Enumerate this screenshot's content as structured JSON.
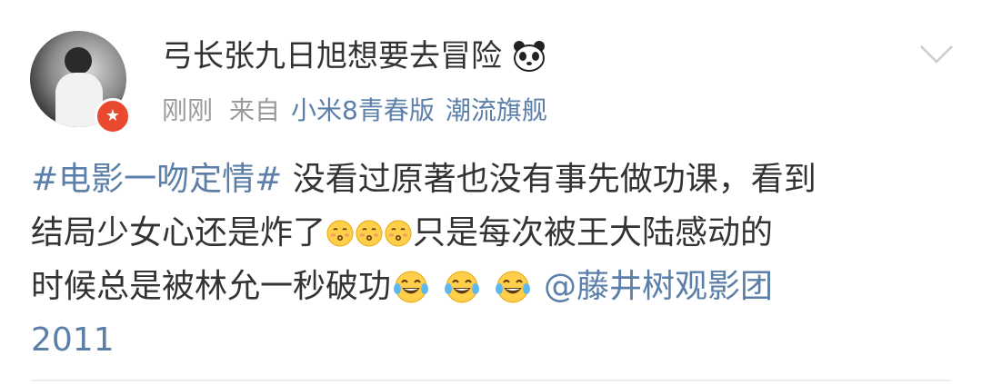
{
  "post": {
    "username": "弓长张九日旭想要去冒险",
    "time": "刚刚",
    "source_prefix": "来自",
    "source_device": "小米8青春版",
    "source_tag": "潮流旗舰",
    "lines": [
      {
        "hashtag": "#电影一吻定情#",
        "text": " 没看过原著也没有事先做功课，看到"
      },
      {
        "text_a": "结局少女心还是炸了",
        "text_b": "只是每次被王大陆感动的"
      },
      {
        "text": "时候总是被林允一秒破功",
        "mention": "@藤井树观影团"
      },
      {
        "number": "2011"
      }
    ]
  },
  "icons": {
    "panda": "panda-emoji-icon",
    "chevron": "chevron-down-icon",
    "badge": "verified-badge-icon",
    "kiss": "kissing-face-emoji-icon",
    "laugh": "tears-of-joy-emoji-icon"
  },
  "colors": {
    "link_blue": "#5b7fa8",
    "text": "#333333",
    "meta": "#9a9a9a",
    "badge": "#e8492f"
  }
}
